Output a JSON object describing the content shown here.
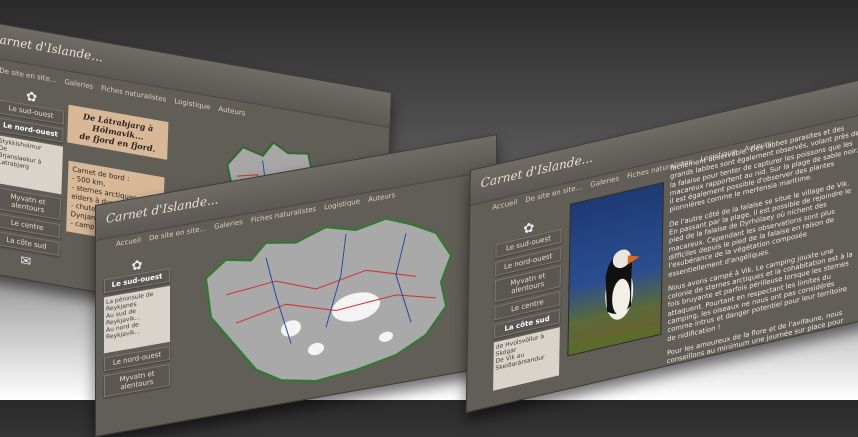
{
  "site": {
    "title": "Carnet d'Islande...",
    "nav": [
      "Accueil",
      "De site en site...",
      "Galeries",
      "Fiches naturalistes",
      "Logistique",
      "Auteurs"
    ]
  },
  "panel_back": {
    "side": [
      "Le sud-ouest",
      "Le nord-ouest",
      "Myvatn et alentours",
      "Le centre",
      "La côte sud"
    ],
    "active": "Le nord-ouest",
    "sub": [
      "Stykkisholmur",
      "De",
      "Brjanslaekur à",
      "Latrabjarg"
    ],
    "heading": [
      "De Látrabjarg à",
      "Hólmavik...",
      "de fjord en fjord."
    ],
    "notes_title": "Carnet de bord :",
    "notes": [
      "- 500 km,",
      "- sternes arctiques et eiders à duvet,",
      "- chutes d'eau de Dynjandi,",
      "- camping en 1996"
    ]
  },
  "panel_middle": {
    "side": [
      "Le sud-ouest",
      "Le nord-ouest",
      "Myvatn et alentours"
    ],
    "active": "Le sud-ouest",
    "sub": [
      "La péninsule de",
      "Reykjanes",
      "Au sud de",
      "Reykjavik...",
      "Au nord de",
      "Reykjavik..."
    ]
  },
  "panel_front": {
    "side": [
      "Le sud-ouest",
      "Le nord-ouest",
      "Myvatn et alentours",
      "Le centre",
      "La côte sud"
    ],
    "active": "La côte sud",
    "sub": [
      "de Hvolsvöllur à",
      "Skógar",
      "De Vik au",
      "Skeiðarársandur"
    ],
    "paragraphs": [
      "facilement observable. Des labbes parasites et des grands labbes sont également observés, volant près de la falaise pour tenter de capturer les poissons que les macareux rapportent au nid. Sur la plage de sable noir, il est également possible d'observer des plantes pionnières comme le mertensia maritime.",
      "De l'autre côté de la falaise se situe le village de Vik. En passant par la plage, il est possible de rejoindre le pied de la falaise de Dyrhólaey où nichent des macareux. Cependant les observations sont plus difficiles depuis le pied de la falaise en raison de l'exubérance de la végétation composée essentiellement d'angéliques.",
      "Nous avons campé à Vik. Le camping jouxte une colonie de sternes arctiques et la cohabitation est à la fois bruyante et parfois périlleuse lorsque les sternes attaquent. Pourtant en respectant les limites du camping, les oiseaux ne nous ont pas considérés comme intrus et danger potentiel pour leur territoire de nidification !",
      "Pour les amoureux de la flore et de l'avifaune, nous conseillons au minimum une journée sur place pour bien profiter de Vik et de Dyrhólaey."
    ]
  }
}
